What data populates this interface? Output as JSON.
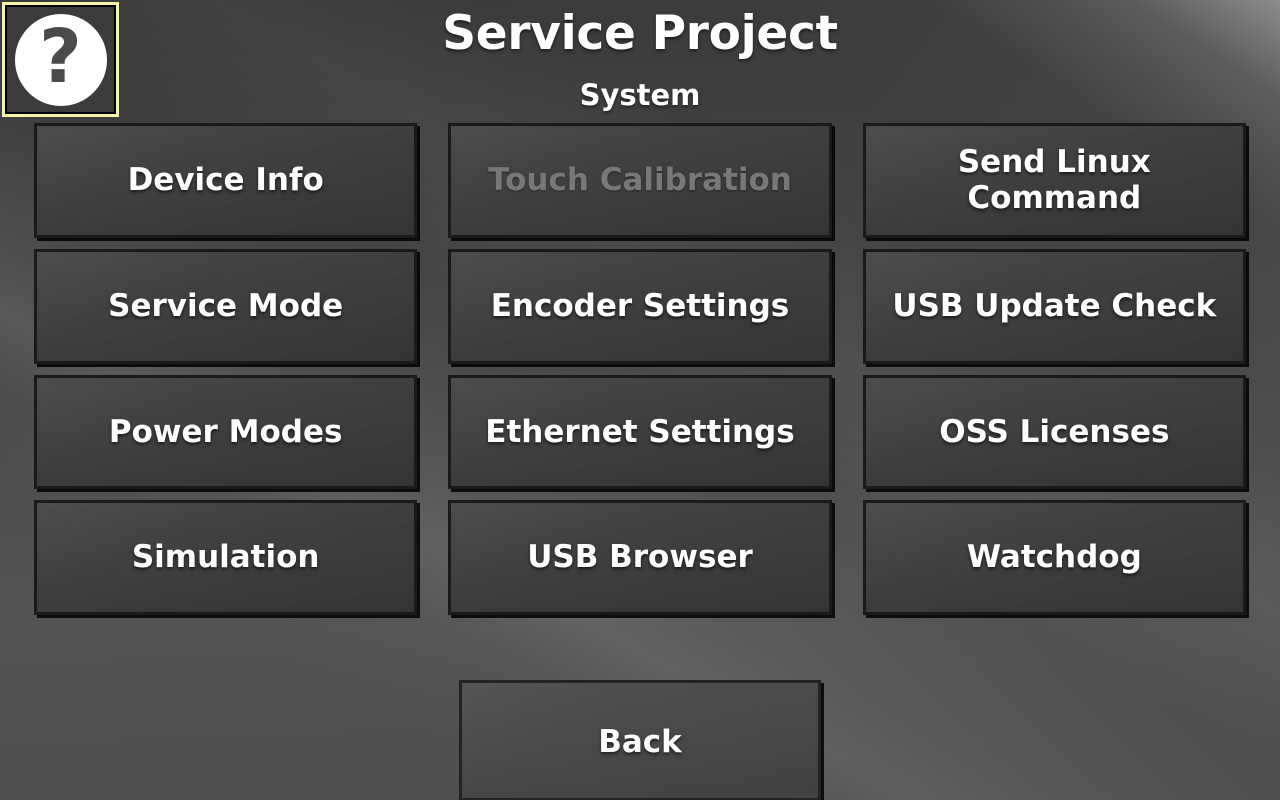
{
  "header": {
    "title": "Service Project",
    "subtitle": "System",
    "help_icon": "question-mark-icon",
    "help_label": "?"
  },
  "colors": {
    "focus_border": "#f4f4a8",
    "tile_border": "#1a1a1a",
    "tile_fill": "#3e3e3e",
    "text": "#ffffff",
    "text_disabled": "#787878",
    "background": "#4a4a4a"
  },
  "grid": {
    "columns": 3,
    "rows": 4,
    "tiles": [
      {
        "label": "Device Info",
        "disabled": false
      },
      {
        "label": "Touch Calibration",
        "disabled": true
      },
      {
        "label": "Send Linux\nCommand",
        "disabled": false
      },
      {
        "label": "Service Mode",
        "disabled": false
      },
      {
        "label": "Encoder Settings",
        "disabled": false
      },
      {
        "label": "USB Update Check",
        "disabled": false
      },
      {
        "label": "Power Modes",
        "disabled": false
      },
      {
        "label": "Ethernet Settings",
        "disabled": false
      },
      {
        "label": "OSS Licenses",
        "disabled": false
      },
      {
        "label": "Simulation",
        "disabled": false
      },
      {
        "label": "USB Browser",
        "disabled": false
      },
      {
        "label": "Watchdog",
        "disabled": false
      }
    ]
  },
  "footer": {
    "back_label": "Back"
  }
}
